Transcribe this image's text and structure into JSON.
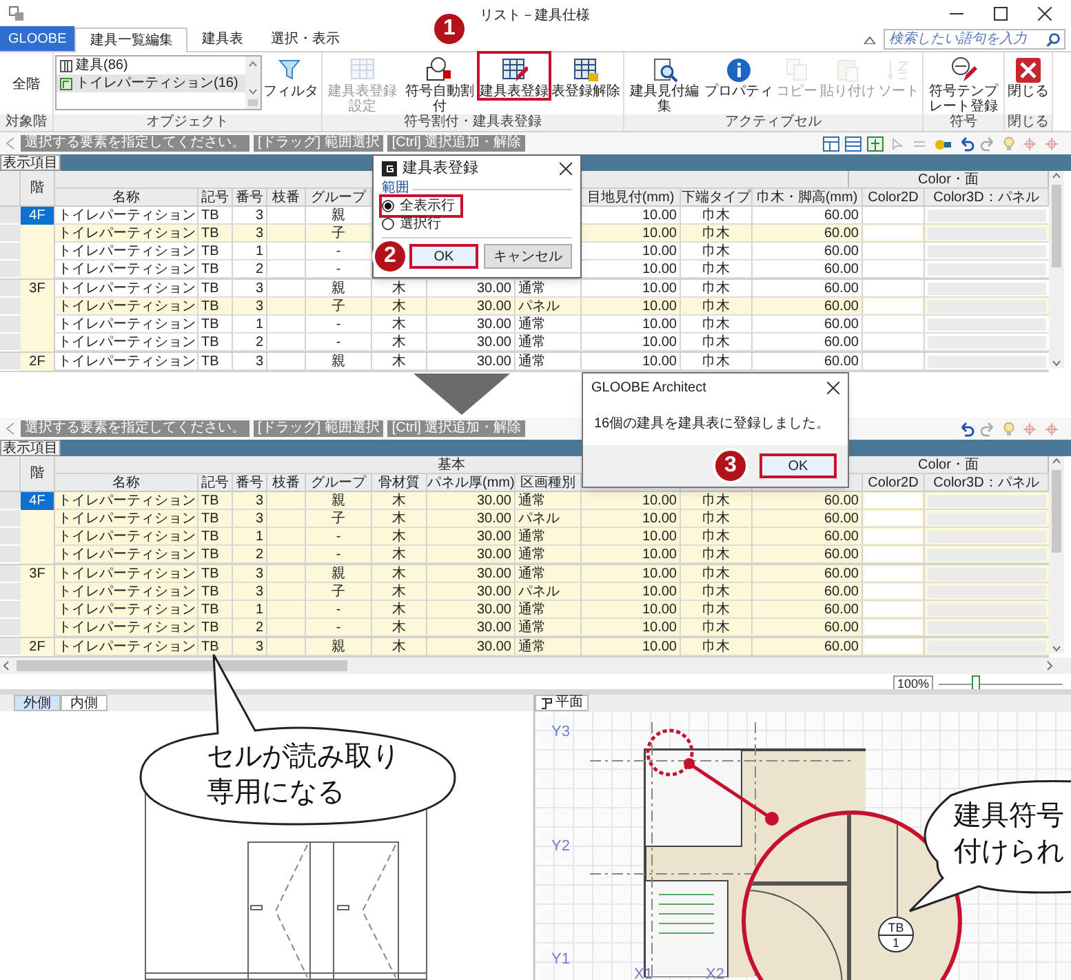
{
  "window": {
    "title": "リスト－建具仕様",
    "search_placeholder": "検索したい語句を入力"
  },
  "ribbon_tabs": [
    {
      "label": "GLOOBE",
      "kind": "app",
      "selected": false
    },
    {
      "label": "建具一覧編集",
      "kind": "tab",
      "selected": true
    },
    {
      "label": "建具表",
      "kind": "tab",
      "selected": false
    },
    {
      "label": "選択・表示",
      "kind": "tab",
      "selected": false
    }
  ],
  "ribbon_groups": [
    {
      "label": "対象階",
      "items": [
        {
          "kind": "label",
          "label": "全階"
        }
      ]
    },
    {
      "label": "オブジェクト",
      "items": [
        {
          "kind": "list",
          "entries": [
            {
              "label": "建具(86)",
              "selected": false
            },
            {
              "label": "トイレパーティション(16)",
              "selected": true
            }
          ]
        },
        {
          "kind": "button",
          "label": "フィルタ",
          "disabled": false,
          "highlighted": false
        }
      ]
    },
    {
      "label": "符号割付・建具表登録",
      "items": [
        {
          "kind": "button",
          "label": "建具表登録設定",
          "disabled": true,
          "highlighted": false
        },
        {
          "kind": "button",
          "label": "符号自動割付",
          "disabled": false,
          "highlighted": false
        },
        {
          "kind": "button",
          "label": "建具表登録",
          "disabled": false,
          "highlighted": true,
          "badge": "1"
        },
        {
          "kind": "button",
          "label": "表登録解除",
          "disabled": false,
          "highlighted": false
        }
      ]
    },
    {
      "label": "アクティブセル",
      "items": [
        {
          "kind": "button",
          "label": "建具見付編集",
          "disabled": false,
          "highlighted": false
        },
        {
          "kind": "button",
          "label": "プロパティ",
          "disabled": false,
          "highlighted": false
        },
        {
          "kind": "button",
          "label": "コピー",
          "disabled": true,
          "highlighted": false
        },
        {
          "kind": "button",
          "label": "貼り付け",
          "disabled": true,
          "highlighted": false
        },
        {
          "kind": "button",
          "label": "ソート",
          "disabled": true,
          "highlighted": false
        }
      ]
    },
    {
      "label": "符号",
      "items": [
        {
          "kind": "button",
          "label": "符号テンプレート登録",
          "disabled": false,
          "highlighted": false
        }
      ]
    },
    {
      "label": "閉じる",
      "items": [
        {
          "kind": "button",
          "label": "閉じる",
          "disabled": false,
          "highlighted": false
        }
      ]
    }
  ],
  "top_view": {
    "hints": [
      "選択する要素を指定してください。",
      "[ドラッグ] 範囲選択",
      "[Ctrl] 選択追加・解除"
    ],
    "panel_title": "表示項目",
    "table": {
      "read_only": false,
      "groups": [
        {
          "kind": "basic"
        },
        {
          "kind": "color",
          "label": "Color・面"
        }
      ],
      "floor_header": "階",
      "columns": [
        {
          "label": "名称"
        },
        {
          "label": "記号"
        },
        {
          "label": "番号"
        },
        {
          "label": "枝番"
        },
        {
          "label": "グループ"
        },
        {},
        {},
        {},
        {
          "label": "目地見付(mm)"
        },
        {
          "label": "下端タイプ"
        },
        {
          "label": "巾木・脚高(mm)"
        },
        {
          "label": "Color2D"
        },
        {
          "label": "Color3D：パネル"
        }
      ],
      "floors": [
        {
          "label": "4F",
          "selected": true,
          "rows": [
            {
              "highlighted": false,
              "cells": [
                "トイレパーティション",
                "TB",
                "3",
                null,
                "親",
                null,
                null,
                null,
                "10.00",
                "巾木",
                "60.00"
              ]
            },
            {
              "highlighted": true,
              "cells": [
                "トイレパーティション",
                "TB",
                "3",
                null,
                "子",
                null,
                null,
                null,
                "10.00",
                "巾木",
                "60.00"
              ]
            },
            {
              "highlighted": false,
              "cells": [
                "トイレパーティション",
                "TB",
                "1",
                null,
                "-",
                null,
                null,
                null,
                "10.00",
                "巾木",
                "60.00"
              ]
            },
            {
              "highlighted": false,
              "cells": [
                "トイレパーティション",
                "TB",
                "2",
                null,
                "-",
                null,
                null,
                null,
                "10.00",
                "巾木",
                "60.00"
              ]
            }
          ]
        },
        {
          "label": "3F",
          "selected": false,
          "rows": [
            {
              "highlighted": false,
              "cells": [
                "トイレパーティション",
                "TB",
                "3",
                null,
                "親",
                "木",
                "30.00",
                "通常",
                "10.00",
                "巾木",
                "60.00"
              ]
            },
            {
              "highlighted": true,
              "cells": [
                "トイレパーティション",
                "TB",
                "3",
                null,
                "子",
                "木",
                "30.00",
                "パネル",
                "10.00",
                "巾木",
                "60.00"
              ]
            },
            {
              "highlighted": false,
              "cells": [
                "トイレパーティション",
                "TB",
                "1",
                null,
                "-",
                "木",
                "30.00",
                "通常",
                "10.00",
                "巾木",
                "60.00"
              ]
            },
            {
              "highlighted": false,
              "cells": [
                "トイレパーティション",
                "TB",
                "2",
                null,
                "-",
                "木",
                "30.00",
                "通常",
                "10.00",
                "巾木",
                "60.00"
              ]
            }
          ]
        },
        {
          "label": "2F",
          "selected": false,
          "rows": [
            {
              "highlighted": false,
              "cells": [
                "トイレパーティション",
                "TB",
                "3",
                null,
                "親",
                "木",
                "30.00",
                "通常",
                "10.00",
                "巾木",
                "60.00"
              ]
            }
          ]
        }
      ]
    },
    "dialog": {
      "title": "建具表登録",
      "group_label": "範囲",
      "options": [
        {
          "label": "全表示行",
          "selected": true,
          "highlighted": true
        },
        {
          "label": "選択行",
          "selected": false,
          "highlighted": false
        }
      ],
      "buttons": [
        {
          "label": "OK",
          "highlighted": true,
          "badge": "2"
        },
        {
          "label": "キャンセル",
          "highlighted": false
        }
      ]
    }
  },
  "bottom_view": {
    "hints": [
      "選択する要素を指定してください。",
      "[ドラッグ] 範囲選択",
      "[Ctrl] 選択追加・解除"
    ],
    "panel_title": "表示項目",
    "table": {
      "read_only": true,
      "groups": [
        {
          "kind": "basic",
          "label": "基本"
        },
        {
          "kind": "color",
          "label": "Color・面"
        }
      ],
      "floor_header": "階",
      "columns": [
        {
          "label": "名称"
        },
        {
          "label": "記号"
        },
        {
          "label": "番号"
        },
        {
          "label": "枝番"
        },
        {
          "label": "グループ"
        },
        {
          "label": "骨材質"
        },
        {
          "label": "パネル厚(mm)"
        },
        {
          "label": "区画種別"
        },
        {},
        {},
        {},
        {
          "label": "Color2D"
        },
        {
          "label": "Color3D：パネル"
        }
      ],
      "floors": [
        {
          "label": "4F",
          "selected": true,
          "rows": [
            {
              "cells": [
                "トイレパーティション",
                "TB",
                "3",
                null,
                "親",
                "木",
                "30.00",
                "通常",
                "10.00",
                "巾木",
                "60.00"
              ]
            },
            {
              "cells": [
                "トイレパーティション",
                "TB",
                "3",
                null,
                "子",
                "木",
                "30.00",
                "パネル",
                "10.00",
                "巾木",
                "60.00"
              ]
            },
            {
              "cells": [
                "トイレパーティション",
                "TB",
                "1",
                null,
                "-",
                "木",
                "30.00",
                "通常",
                "10.00",
                "巾木",
                "60.00"
              ]
            },
            {
              "cells": [
                "トイレパーティション",
                "TB",
                "2",
                null,
                "-",
                "木",
                "30.00",
                "通常",
                "10.00",
                "巾木",
                "60.00"
              ]
            }
          ]
        },
        {
          "label": "3F",
          "selected": false,
          "rows": [
            {
              "cells": [
                "トイレパーティション",
                "TB",
                "3",
                null,
                "親",
                "木",
                "30.00",
                "通常",
                "10.00",
                "巾木",
                "60.00"
              ]
            },
            {
              "cells": [
                "トイレパーティション",
                "TB",
                "3",
                null,
                "子",
                "木",
                "30.00",
                "パネル",
                "10.00",
                "巾木",
                "60.00"
              ]
            },
            {
              "cells": [
                "トイレパーティション",
                "TB",
                "1",
                null,
                "-",
                "木",
                "30.00",
                "通常",
                "10.00",
                "巾木",
                "60.00"
              ]
            },
            {
              "cells": [
                "トイレパーティション",
                "TB",
                "2",
                null,
                "-",
                "木",
                "30.00",
                "通常",
                "10.00",
                "巾木",
                "60.00"
              ]
            }
          ]
        },
        {
          "label": "2F",
          "selected": false,
          "rows": [
            {
              "cells": [
                "トイレパーティション",
                "TB",
                "3",
                null,
                "親",
                "木",
                "30.00",
                "通常",
                "10.00",
                "巾木",
                "60.00"
              ]
            }
          ]
        }
      ]
    },
    "zoom": {
      "label": "100%",
      "level": 0.3
    },
    "message_box": {
      "title": "GLOOBE Architect",
      "message": "16個の建具を建具表に登録しました。",
      "button": {
        "label": "OK",
        "highlighted": true,
        "badge": "3"
      }
    }
  },
  "elevation": {
    "tabs": [
      {
        "label": "外側",
        "selected": true
      },
      {
        "label": "内側",
        "selected": false
      }
    ]
  },
  "plan": {
    "tab": "平面",
    "axis_labels": [
      "Y3",
      "Y2",
      "Y1",
      "X1",
      "X2"
    ],
    "tag": {
      "code": "TB",
      "number": "1"
    }
  },
  "callouts": [
    {
      "lines": [
        "セルが読み取り",
        "専用になる"
      ]
    },
    {
      "lines": [
        "建具符号",
        "付けられ"
      ]
    }
  ]
}
